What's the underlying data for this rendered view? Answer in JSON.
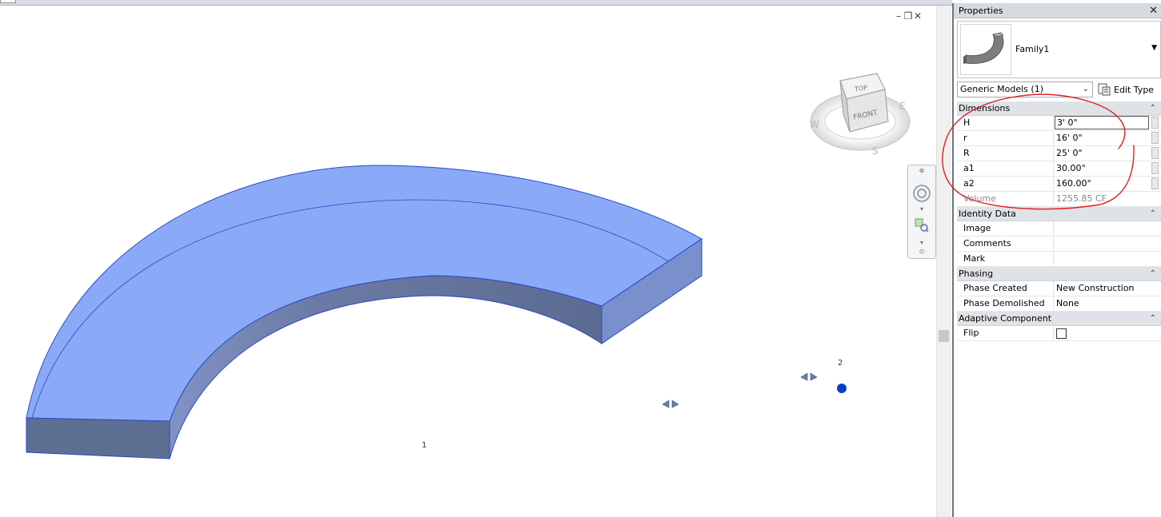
{
  "viewport": {
    "point_labels": [
      "1",
      "2"
    ],
    "viewcube": {
      "top": "TOP",
      "front": "FRONT",
      "west": "W",
      "east": "E",
      "south": "S"
    },
    "controls": [
      "minimize-icon",
      "restore-icon",
      "close-icon"
    ]
  },
  "properties": {
    "title": "Properties",
    "close": "✕",
    "family_name": "Family1",
    "filter_label": "Generic Models (1)",
    "edit_type_label": "Edit Type",
    "groups": {
      "dimensions": "Dimensions",
      "identity": "Identity Data",
      "phasing": "Phasing",
      "adaptive": "Adaptive Component"
    },
    "dimensions": {
      "H": {
        "label": "H",
        "value": "3'  0\""
      },
      "r": {
        "label": "r",
        "value": "16'  0\""
      },
      "R": {
        "label": "R",
        "value": "25'  0\""
      },
      "a1": {
        "label": "a1",
        "value": "30.00°"
      },
      "a2": {
        "label": "a2",
        "value": "160.00°"
      },
      "volume": {
        "label": "Volume",
        "value": "1255.85 CF"
      }
    },
    "identity": {
      "image": {
        "label": "Image",
        "value": ""
      },
      "comments": {
        "label": "Comments",
        "value": ""
      },
      "mark": {
        "label": "Mark",
        "value": ""
      }
    },
    "phasing": {
      "created": {
        "label": "Phase Created",
        "value": "New Construction"
      },
      "demolished": {
        "label": "Phase Demolished",
        "value": "None"
      }
    },
    "adaptive": {
      "flip": {
        "label": "Flip",
        "checked": false
      }
    }
  },
  "colors": {
    "model_top": "#8aaaf8",
    "model_side": "#5e6f94",
    "model_edge": "#1f3fd0",
    "annotation": "#e02020",
    "point": "#0a3fc8"
  }
}
